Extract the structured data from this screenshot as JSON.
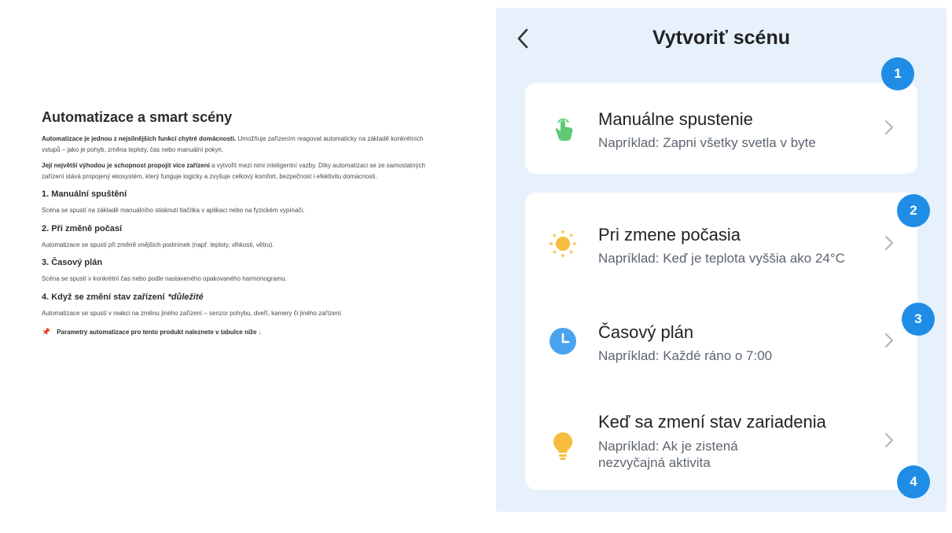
{
  "article": {
    "title": "Automatizace a smart scény",
    "intro1_bold": "Automatizace je jednou z nejsilnějších funkcí chytré domácnosti.",
    "intro1_rest": " Umožňuje zařízením reagovat automaticky na základě konkrétních vstupů – jako je pohyb, změna teploty, čas nebo manuální pokyn.",
    "intro2_bold": "Její největší výhodou je schopnost propojit více zařízení",
    "intro2_rest": " a vytvořit mezi nimi inteligentní vazby. Díky automatizaci se ze samostatných zařízení stává propojený ekosystém, který funguje logicky a zvyšuje celkový komfort, bezpečnost i efektivitu domácnosti.",
    "sections": [
      {
        "heading": "1. Manuální spuštění",
        "text": "Scéna se spustí na základě manuálního stisknutí tlačítka v aplikaci nebo na fyzickém vypínači."
      },
      {
        "heading": "2. Při změně počasí",
        "text": "Automatizace se spustí při změně vnějších podmínek (např. teploty, vlhkosti, větru)."
      },
      {
        "heading": "3. Časový plán",
        "text": "Scéna se spustí v konkrétní čas nebo podle nastaveného opakovaného harmonogramu."
      },
      {
        "heading": "4. Když se změní stav zařízení",
        "important": "*důležité",
        "text": "Automatizace se spustí v reakci na změnu jiného zařízení – senzor pohybu, dveří, kamery či jiného zařízení."
      }
    ],
    "note": "Parametry automatizace pro tento produkt naleznete v tabulce níže",
    "note_arrow": "↓",
    "note_icon": "pushpin-icon"
  },
  "app": {
    "title": "Vytvoriť scénu",
    "back_icon": "back-chevron-icon",
    "accent": "#1f8de6",
    "background": "#e6f1fc",
    "options": [
      {
        "title": "Manuálne spustenie",
        "subtitle": "Napríklad: Zapni všetky svetla v byte",
        "icon": "hand-tap-icon",
        "badge": "1"
      },
      {
        "title": "Pri zmene počasia",
        "subtitle": "Napríklad: Keď je teplota vyššia ako 24°C",
        "icon": "sun-icon",
        "badge": "2"
      },
      {
        "title": "Časový plán",
        "subtitle": "Napríklad: Každé ráno o 7:00",
        "icon": "clock-icon",
        "badge": "3"
      },
      {
        "title": "Keď sa zmení stav zariadenia",
        "subtitle": "Napríklad: Ak je zistená nezvyčajná aktivita",
        "icon": "lightbulb-icon",
        "badge": "4"
      }
    ]
  }
}
